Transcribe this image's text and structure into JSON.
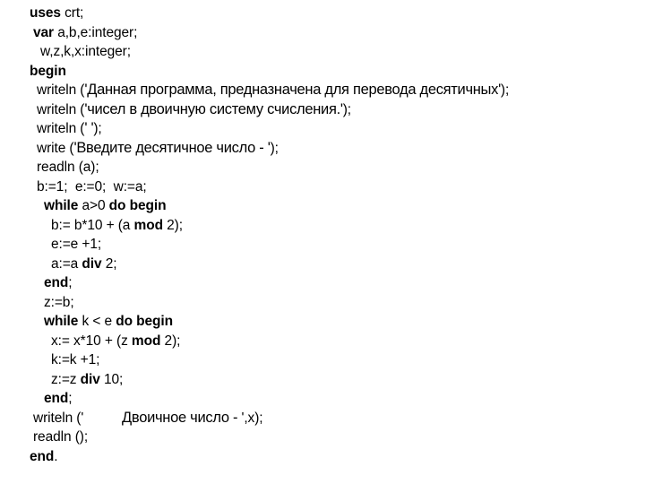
{
  "document": {
    "language": "Pascal",
    "lines": [
      {
        "indent": 0,
        "tokens": [
          {
            "t": "uses",
            "kw": true
          },
          {
            "t": " crt;"
          }
        ]
      },
      {
        "indent": 1,
        "tokens": [
          {
            "t": "var",
            "kw": true
          },
          {
            "t": " a,b,e:integer;"
          }
        ]
      },
      {
        "indent": 3,
        "tokens": [
          {
            "t": "w,z,k,x:integer;"
          }
        ]
      },
      {
        "indent": 0,
        "tokens": [
          {
            "t": "begin",
            "kw": true
          }
        ]
      },
      {
        "indent": 2,
        "tokens": [
          {
            "t": "writeln ("
          },
          {
            "t": "'Данная программа, предназначена для перевода десятичных'",
            "str": true
          },
          {
            "t": ");"
          }
        ]
      },
      {
        "indent": 2,
        "tokens": [
          {
            "t": "writeln ("
          },
          {
            "t": "'чисел в двоичную систему счисления.'",
            "str": true
          },
          {
            "t": ");"
          }
        ]
      },
      {
        "indent": 2,
        "tokens": [
          {
            "t": "writeln ("
          },
          {
            "t": "' '",
            "str": true
          },
          {
            "t": ");"
          }
        ]
      },
      {
        "indent": 2,
        "tokens": [
          {
            "t": "write ("
          },
          {
            "t": "'Введите десятичное число - '",
            "str": true
          },
          {
            "t": ");"
          }
        ]
      },
      {
        "indent": 2,
        "tokens": [
          {
            "t": "readln (a);"
          }
        ]
      },
      {
        "indent": 2,
        "tokens": [
          {
            "t": "b:=1;  e:=0;  w:=a;"
          }
        ]
      },
      {
        "indent": 4,
        "tokens": [
          {
            "t": "while",
            "kw": true
          },
          {
            "t": " a>0 "
          },
          {
            "t": "do begin",
            "kw": true
          }
        ]
      },
      {
        "indent": 6,
        "tokens": [
          {
            "t": "b:= b*10 + (a "
          },
          {
            "t": "mod",
            "kw": true
          },
          {
            "t": " 2);"
          }
        ]
      },
      {
        "indent": 6,
        "tokens": [
          {
            "t": "e:=e +1;"
          }
        ]
      },
      {
        "indent": 6,
        "tokens": [
          {
            "t": "a:=a "
          },
          {
            "t": "div",
            "kw": true
          },
          {
            "t": " 2;"
          }
        ]
      },
      {
        "indent": 4,
        "tokens": [
          {
            "t": "end",
            "kw": true
          },
          {
            "t": ";"
          }
        ]
      },
      {
        "indent": 4,
        "tokens": [
          {
            "t": "z:=b;"
          }
        ]
      },
      {
        "indent": 4,
        "tokens": [
          {
            "t": "while",
            "kw": true
          },
          {
            "t": " k < e "
          },
          {
            "t": "do begin",
            "kw": true
          }
        ]
      },
      {
        "indent": 6,
        "tokens": [
          {
            "t": "x:= x*10 + (z "
          },
          {
            "t": "mod",
            "kw": true
          },
          {
            "t": " 2);"
          }
        ]
      },
      {
        "indent": 6,
        "tokens": [
          {
            "t": "k:=k +1;"
          }
        ]
      },
      {
        "indent": 6,
        "tokens": [
          {
            "t": "z:=z "
          },
          {
            "t": "div",
            "kw": true
          },
          {
            "t": " 10;"
          }
        ]
      },
      {
        "indent": 4,
        "tokens": [
          {
            "t": "end",
            "kw": true
          },
          {
            "t": ";"
          }
        ]
      },
      {
        "indent": 1,
        "tokens": [
          {
            "t": "writeln ('"
          },
          {
            "t": "          Двоичное число - ",
            "str": true
          },
          {
            "t": "',x);"
          }
        ]
      },
      {
        "indent": 1,
        "tokens": [
          {
            "t": "readln ();"
          }
        ]
      },
      {
        "indent": 0,
        "tokens": [
          {
            "t": "end",
            "kw": true
          },
          {
            "t": "."
          }
        ]
      }
    ]
  }
}
